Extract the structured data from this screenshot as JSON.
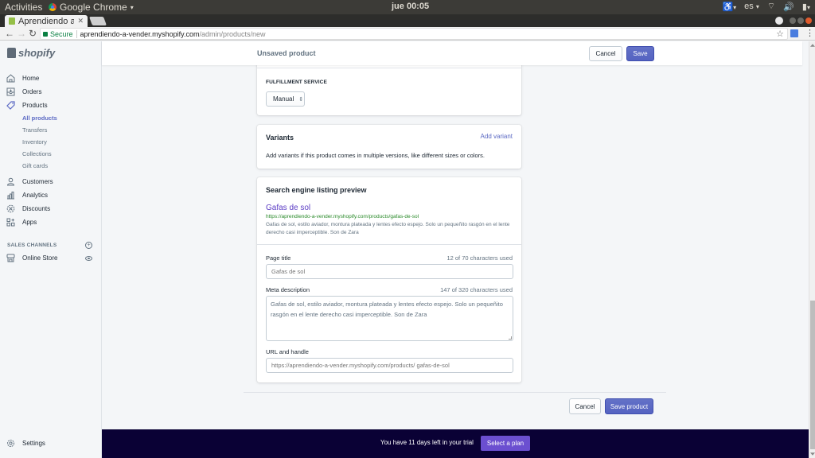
{
  "os": {
    "activities": "Activities",
    "app_name": "Google Chrome",
    "clock": "jue 00:05",
    "language": "es"
  },
  "browser": {
    "tab_title": "Aprendiendo a",
    "secure_label": "Secure",
    "url_host": "aprendiendo-a-vender.myshopify.com",
    "url_path": "/admin/products/new"
  },
  "sidebar": {
    "logo": "shopify",
    "items": [
      {
        "label": "Home",
        "icon": "home-icon"
      },
      {
        "label": "Orders",
        "icon": "orders-icon"
      },
      {
        "label": "Products",
        "icon": "tag-icon"
      }
    ],
    "product_subitems": [
      {
        "label": "All products",
        "active": true
      },
      {
        "label": "Transfers"
      },
      {
        "label": "Inventory"
      },
      {
        "label": "Collections"
      },
      {
        "label": "Gift cards"
      }
    ],
    "items2": [
      {
        "label": "Customers",
        "icon": "person-icon"
      },
      {
        "label": "Analytics",
        "icon": "bar-chart-icon"
      },
      {
        "label": "Discounts",
        "icon": "discount-icon"
      },
      {
        "label": "Apps",
        "icon": "apps-icon"
      }
    ],
    "sales_channels_label": "SALES CHANNELS",
    "online_store": "Online Store",
    "settings": "Settings"
  },
  "topbar": {
    "title": "Unsaved product",
    "cancel": "Cancel",
    "save": "Save"
  },
  "fulfillment": {
    "label": "FULFILLMENT SERVICE",
    "selected": "Manual"
  },
  "variants": {
    "title": "Variants",
    "add_link": "Add variant",
    "description": "Add variants if this product comes in multiple versions, like different sizes or colors."
  },
  "seo": {
    "title": "Search engine listing preview",
    "preview_title": "Gafas de sol",
    "preview_url": "https://aprendiendo-a-vender.myshopify.com/products/gafas-de-sol",
    "preview_description": "Gafas de sol, estilo aviador, montura plateada y lentes efecto espejo. Solo un pequeñito rasgón en el lente derecho casi imperceptible. Son de Zara",
    "page_title_label": "Page title",
    "page_title_count": "12 of 70 characters used",
    "page_title_placeholder": "Gafas de sol",
    "meta_label": "Meta description",
    "meta_count": "147 of 320 characters used",
    "meta_placeholder": "Gafas de sol, estilo aviador, montura plateada y lentes efecto espejo. Solo un pequeñito rasgón en el lente derecho casi imperceptible. Son de Zara",
    "url_label": "URL and handle",
    "url_placeholder": "https://aprendiendo-a-vender.myshopify.com/products/ gafas-de-sol"
  },
  "footer": {
    "cancel": "Cancel",
    "save_product": "Save product"
  },
  "trial": {
    "message": "You have 11 days left in your trial",
    "button": "Select a plan"
  },
  "colors": {
    "accent": "#5c6ac4",
    "banner_bg": "#0a0135",
    "seo_url_green": "#2a8a2a"
  }
}
